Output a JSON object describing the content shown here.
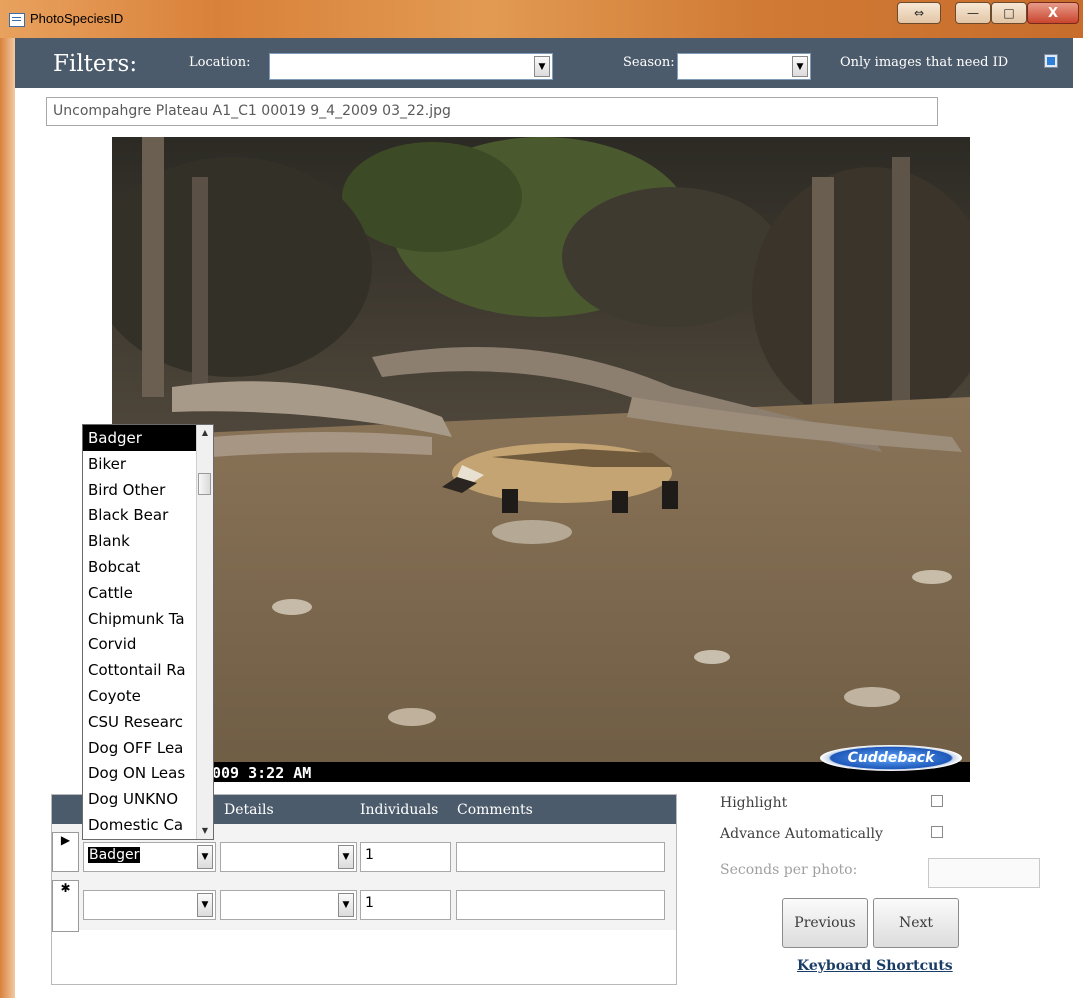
{
  "window": {
    "title": "PhotoSpeciesID",
    "close_glyph": "X",
    "restore_glyph": "⇔",
    "min_glyph": "—",
    "max_glyph": "□"
  },
  "filters": {
    "heading": "Filters:",
    "location_label": "Location:",
    "location_value": "",
    "season_label": "Season:",
    "season_value": "",
    "needs_id_label": "Only images that need ID",
    "needs_id_checked": true
  },
  "image": {
    "filename": "Uncompahgre Plateau A1_C1 00019 9_4_2009 03_22.jpg",
    "timestamp": "009  3:22 AM",
    "camera_brand": "Cuddeback"
  },
  "species_list": {
    "items": [
      "Badger",
      "Biker",
      "Bird Other",
      "Black Bear",
      "Blank",
      "Bobcat",
      "Cattle",
      "Chipmunk Ta",
      "Corvid",
      "Cottontail Ra",
      "Coyote",
      "CSU Researc",
      "Dog OFF Lea",
      "Dog ON Leas",
      "Dog UNKNO",
      "Domestic Ca"
    ],
    "selected": "Badger"
  },
  "grid": {
    "columns": {
      "details": "Details",
      "individuals": "Individuals",
      "comments": "Comments"
    },
    "rows": [
      {
        "selector": "▶",
        "species": "Badger",
        "details": "",
        "individuals": "1",
        "comments": ""
      },
      {
        "selector": "✱",
        "species": "",
        "details": "",
        "individuals": "1",
        "comments": ""
      }
    ]
  },
  "options": {
    "highlight_label": "Highlight",
    "highlight_checked": false,
    "advance_label": "Advance Automatically",
    "advance_checked": false,
    "seconds_label": "Seconds per photo:",
    "seconds_value": ""
  },
  "nav": {
    "previous": "Previous",
    "next": "Next",
    "shortcuts": "Keyboard Shortcuts"
  }
}
